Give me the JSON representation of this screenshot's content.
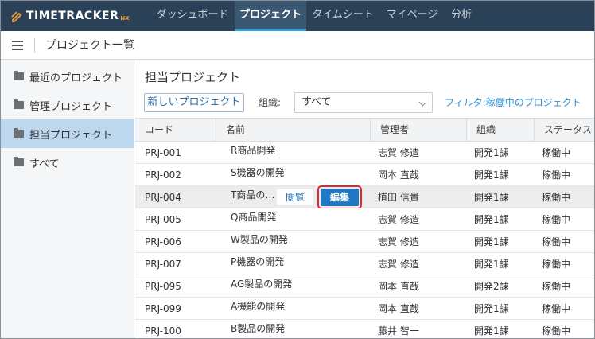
{
  "app": {
    "logo_text": "TIMETRACKER",
    "logo_sub": "NX"
  },
  "nav": {
    "items": [
      {
        "label": "ダッシュボード"
      },
      {
        "label": "プロジェクト"
      },
      {
        "label": "タイムシート"
      },
      {
        "label": "マイページ"
      },
      {
        "label": "分析"
      }
    ],
    "active_index": 1
  },
  "subheader": {
    "title": "プロジェクト一覧"
  },
  "sidebar": {
    "items": [
      {
        "label": "最近のプロジェクト"
      },
      {
        "label": "管理プロジェクト"
      },
      {
        "label": "担当プロジェクト"
      },
      {
        "label": "すべて"
      }
    ],
    "active_index": 2
  },
  "main": {
    "section_title": "担当プロジェクト",
    "new_button": "新しいプロジェクト",
    "org_label": "組織:",
    "org_value": "すべて",
    "filter_link": "フィルタ:稼働中のプロジェクト"
  },
  "table": {
    "columns": [
      "コード",
      "名前",
      "管理者",
      "組織",
      "ステータス"
    ],
    "rows": [
      {
        "code": "PRJ-001",
        "name": "R商品開発",
        "manager": "志賀 修造",
        "org": "開発1課",
        "status": "稼働中"
      },
      {
        "code": "PRJ-002",
        "name": "S機器の開発",
        "manager": "岡本 直哉",
        "org": "開発1課",
        "status": "稼働中"
      },
      {
        "code": "PRJ-004",
        "name": "T商品の…",
        "manager": "植田 信貴",
        "org": "開発1課",
        "status": "稼働中"
      },
      {
        "code": "PRJ-005",
        "name": "Q商品開発",
        "manager": "志賀 修造",
        "org": "開発1課",
        "status": "稼働中"
      },
      {
        "code": "PRJ-006",
        "name": "W製品の開発",
        "manager": "志賀 修造",
        "org": "開発1課",
        "status": "稼働中"
      },
      {
        "code": "PRJ-007",
        "name": "P機器の開発",
        "manager": "志賀 修造",
        "org": "開発1課",
        "status": "稼働中"
      },
      {
        "code": "PRJ-095",
        "name": "AG製品の開発",
        "manager": "岡本 直哉",
        "org": "開発2課",
        "status": "稼働中"
      },
      {
        "code": "PRJ-099",
        "name": "A機能の開発",
        "manager": "岡本 直哉",
        "org": "開発1課",
        "status": "稼働中"
      },
      {
        "code": "PRJ-100",
        "name": "B製品の開発",
        "manager": "藤井 智一",
        "org": "開発1課",
        "status": "稼働中"
      }
    ],
    "row_actions": {
      "view": "閲覧",
      "edit": "編集"
    }
  },
  "colors": {
    "nav_bg": "#2b4157",
    "accent": "#1f78c1",
    "highlight": "#e0282e",
    "sidebar_active": "#bcd7ee"
  }
}
